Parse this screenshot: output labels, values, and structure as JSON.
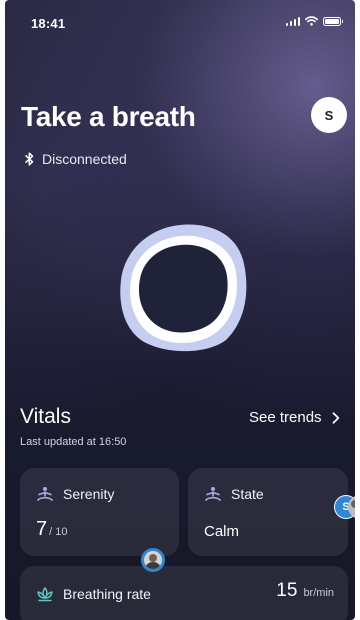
{
  "status_bar": {
    "time": "18:41"
  },
  "header": {
    "title": "Take a breath",
    "avatar_initial": "S"
  },
  "connection": {
    "status": "Disconnected",
    "icon": "bluetooth-icon"
  },
  "breath_visual": {
    "outer_color": "#c5cdf0",
    "inner_color": "#ffffff",
    "core_color": "#20223a"
  },
  "vitals": {
    "title": "Vitals",
    "see_trends_label": "See trends",
    "last_updated": "Last updated at 16:50",
    "cards": {
      "serenity": {
        "label": "Serenity",
        "icon": "meditation-icon",
        "value": "7",
        "unit": "/ 10"
      },
      "state": {
        "label": "State",
        "icon": "meditation-icon",
        "value": "Calm"
      },
      "breathing_rate": {
        "label": "Breathing rate",
        "icon": "lotus-icon",
        "value": "15",
        "unit": "br/min"
      }
    }
  },
  "presence": {
    "initial": "S",
    "accent_color": "#2f86d6"
  }
}
